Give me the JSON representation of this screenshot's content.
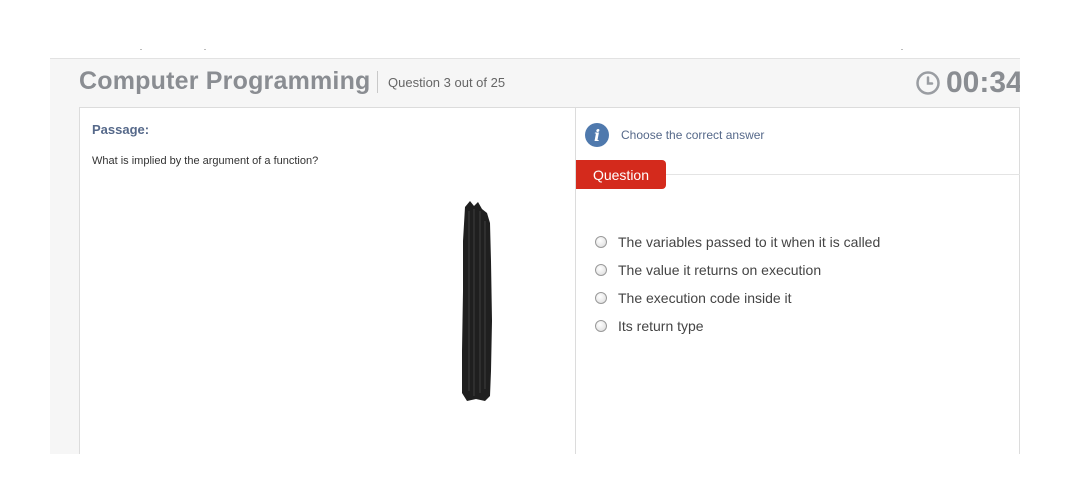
{
  "header": {
    "title": "Computer Programming",
    "question_counter": "Question 3 out of 25",
    "timer": "00:34",
    "timer_icon": "clock-icon"
  },
  "passage": {
    "label": "Passage:",
    "text": "What is implied by the argument of a function?"
  },
  "question_panel": {
    "instruction_icon": "info-icon",
    "instruction": "Choose the correct answer",
    "tab_label": "Question",
    "options": [
      {
        "label": "The variables passed to it when it is called"
      },
      {
        "label": "The value it returns on execution"
      },
      {
        "label": "The execution code inside it"
      },
      {
        "label": "Its return type"
      }
    ]
  },
  "colors": {
    "accent_red": "#d42a1c",
    "title_gray": "#8a8d92",
    "label_blue": "#56698a",
    "info_blue": "#4f79ad"
  }
}
